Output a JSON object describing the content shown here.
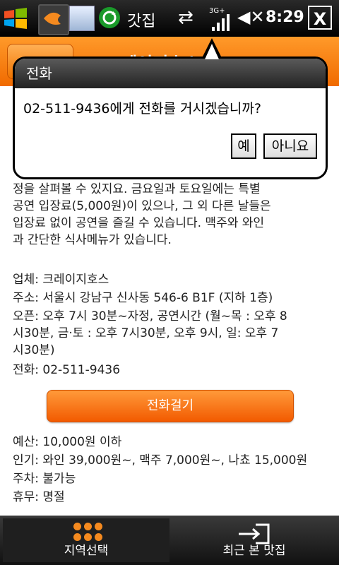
{
  "status_bar": {
    "app_name": "갓집",
    "time": "8:29",
    "network": "3G+",
    "close_label": "X"
  },
  "header": {
    "title": "크레이지호스"
  },
  "content": {
    "paragraph_lines": [
      "정을 살펴볼 수 있지요. 금요일과 토요일에는 특별",
      "공연 입장료(5,000원)이 있으나, 그 외 다른 날들은",
      "입장료 없이 공연을 즐길 수 있습니다. 맥주와 와인",
      "과 간단한 식사메뉴가 있습니다."
    ],
    "info_lines": [
      "업체: 크레이지호스",
      "주소: 서울시 강남구 신사동 546-6 B1F (지하 1층)",
      "오픈: 오후 7시 30분~자정, 공연시간 (월~목 : 오후 8",
      "시30분, 금·토 : 오후 7시30분, 오후 9시, 일: 오후 7",
      "시30분)",
      "전화: 02-511-9436"
    ],
    "call_button_label": "전화걸기",
    "extra_lines": [
      "예산: 10,000원 이하",
      "인기: 와인 39,000원~, 맥주 7,000원~, 나쵸 15,000원",
      "주차: 불가능",
      "휴무: 명절"
    ]
  },
  "dialog": {
    "title": "전화",
    "message": "02-511-9436에게 전화를 거시겠습니까?",
    "yes_label": "예",
    "no_label": "아니요"
  },
  "tabs": {
    "region_label": "지역선택",
    "recent_label": "최근 본 맛집"
  },
  "colors": {
    "accent": "#f58a1f",
    "header": "#f06a00"
  }
}
